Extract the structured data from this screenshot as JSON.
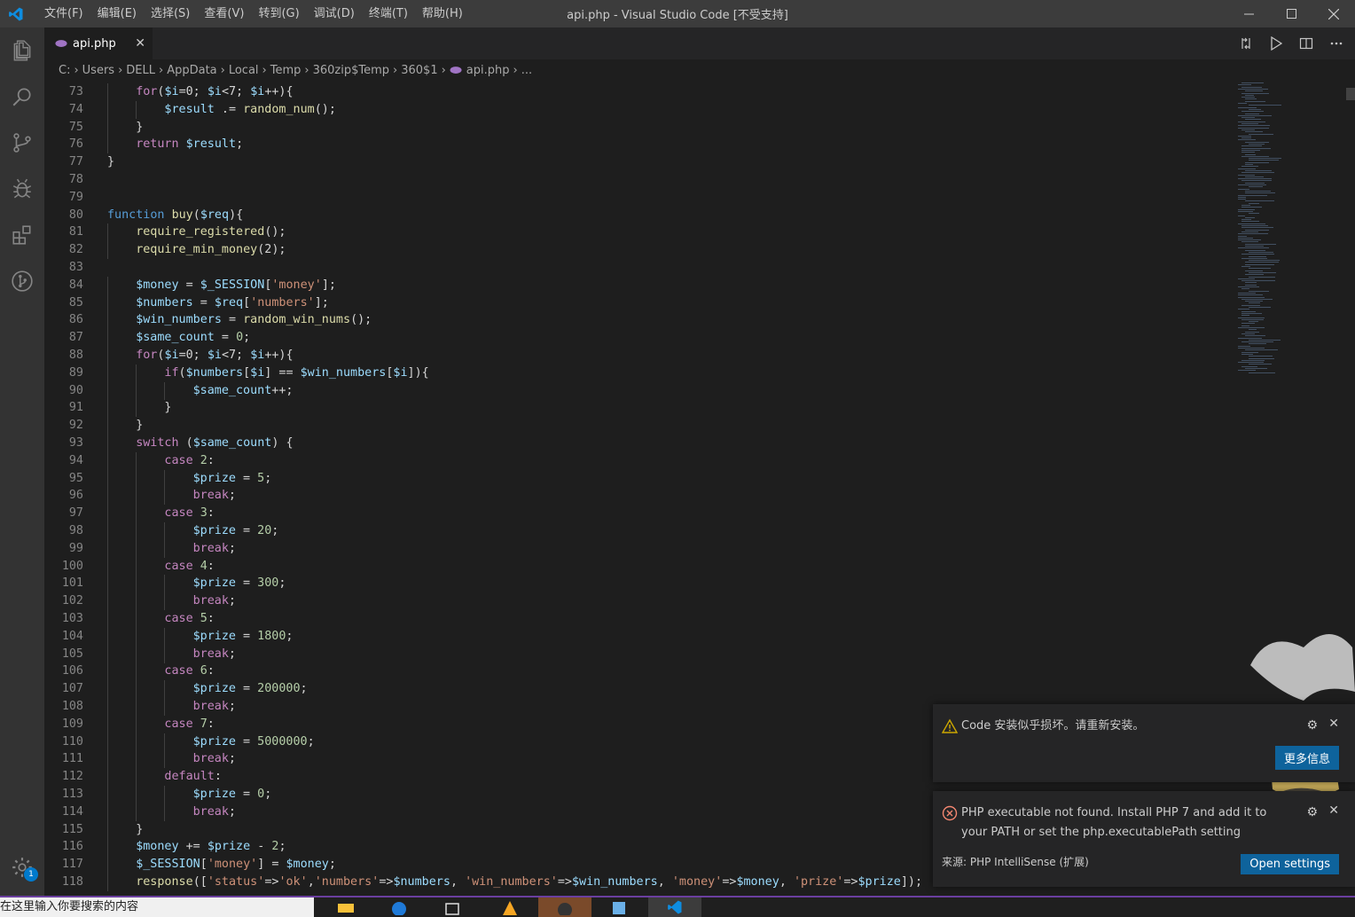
{
  "titlebar": {
    "menu": [
      "文件(F)",
      "编辑(E)",
      "选择(S)",
      "查看(V)",
      "转到(G)",
      "调试(D)",
      "终端(T)",
      "帮助(H)"
    ],
    "title": "api.php - Visual Studio Code [不受支持]"
  },
  "tab": {
    "label": "api.php"
  },
  "breadcrumb": [
    "C:",
    "Users",
    "DELL",
    "AppData",
    "Local",
    "Temp",
    "360zip$Temp",
    "360$1",
    "api.php",
    "..."
  ],
  "editor": {
    "lines": [
      {
        "n": "73",
        "indent": 1,
        "tokens": [
          [
            "ctl",
            "for"
          ],
          [
            "p",
            "("
          ],
          [
            "var",
            "$i"
          ],
          [
            "p",
            "=0; "
          ],
          [
            "var",
            "$i"
          ],
          [
            "p",
            "<7; "
          ],
          [
            "var",
            "$i"
          ],
          [
            "p",
            "++){"
          ]
        ]
      },
      {
        "n": "74",
        "indent": 2,
        "tokens": [
          [
            "var",
            "$result"
          ],
          [
            "p",
            " .= "
          ],
          [
            "fn",
            "random_num"
          ],
          [
            "p",
            "();"
          ]
        ]
      },
      {
        "n": "75",
        "indent": 1,
        "tokens": [
          [
            "p",
            "}"
          ]
        ]
      },
      {
        "n": "76",
        "indent": 1,
        "tokens": [
          [
            "ctl",
            "return"
          ],
          [
            "p",
            " "
          ],
          [
            "var",
            "$result"
          ],
          [
            "p",
            ";"
          ]
        ]
      },
      {
        "n": "77",
        "indent": 0,
        "tokens": [
          [
            "p",
            "}"
          ]
        ]
      },
      {
        "n": "78",
        "indent": 0,
        "tokens": []
      },
      {
        "n": "79",
        "indent": 0,
        "tokens": []
      },
      {
        "n": "80",
        "indent": 0,
        "tokens": [
          [
            "kw",
            "function"
          ],
          [
            "p",
            " "
          ],
          [
            "fn",
            "buy"
          ],
          [
            "p",
            "("
          ],
          [
            "var",
            "$req"
          ],
          [
            "p",
            "){"
          ]
        ]
      },
      {
        "n": "81",
        "indent": 1,
        "tokens": [
          [
            "fn",
            "require_registered"
          ],
          [
            "p",
            "();"
          ]
        ]
      },
      {
        "n": "82",
        "indent": 1,
        "tokens": [
          [
            "fn",
            "require_min_money"
          ],
          [
            "p",
            "(2);"
          ]
        ]
      },
      {
        "n": "83",
        "indent": 0,
        "tokens": []
      },
      {
        "n": "84",
        "indent": 1,
        "tokens": [
          [
            "var",
            "$money"
          ],
          [
            "p",
            " = "
          ],
          [
            "var",
            "$_SESSION"
          ],
          [
            "p",
            "["
          ],
          [
            "str",
            "'money'"
          ],
          [
            "p",
            "];"
          ]
        ]
      },
      {
        "n": "85",
        "indent": 1,
        "tokens": [
          [
            "var",
            "$numbers"
          ],
          [
            "p",
            " = "
          ],
          [
            "var",
            "$req"
          ],
          [
            "p",
            "["
          ],
          [
            "str",
            "'numbers'"
          ],
          [
            "p",
            "];"
          ]
        ]
      },
      {
        "n": "86",
        "indent": 1,
        "tokens": [
          [
            "var",
            "$win_numbers"
          ],
          [
            "p",
            " = "
          ],
          [
            "fn",
            "random_win_nums"
          ],
          [
            "p",
            "();"
          ]
        ]
      },
      {
        "n": "87",
        "indent": 1,
        "tokens": [
          [
            "var",
            "$same_count"
          ],
          [
            "p",
            " = "
          ],
          [
            "num",
            "0"
          ],
          [
            "p",
            ";"
          ]
        ]
      },
      {
        "n": "88",
        "indent": 1,
        "tokens": [
          [
            "ctl",
            "for"
          ],
          [
            "p",
            "("
          ],
          [
            "var",
            "$i"
          ],
          [
            "p",
            "=0; "
          ],
          [
            "var",
            "$i"
          ],
          [
            "p",
            "<7; "
          ],
          [
            "var",
            "$i"
          ],
          [
            "p",
            "++){"
          ]
        ]
      },
      {
        "n": "89",
        "indent": 2,
        "tokens": [
          [
            "ctl",
            "if"
          ],
          [
            "p",
            "("
          ],
          [
            "var",
            "$numbers"
          ],
          [
            "p",
            "["
          ],
          [
            "var",
            "$i"
          ],
          [
            "p",
            "] == "
          ],
          [
            "var",
            "$win_numbers"
          ],
          [
            "p",
            "["
          ],
          [
            "var",
            "$i"
          ],
          [
            "p",
            "]){"
          ]
        ]
      },
      {
        "n": "90",
        "indent": 3,
        "tokens": [
          [
            "var",
            "$same_count"
          ],
          [
            "p",
            "++;"
          ]
        ]
      },
      {
        "n": "91",
        "indent": 2,
        "tokens": [
          [
            "p",
            "}"
          ]
        ]
      },
      {
        "n": "92",
        "indent": 1,
        "tokens": [
          [
            "p",
            "}"
          ]
        ]
      },
      {
        "n": "93",
        "indent": 1,
        "tokens": [
          [
            "ctl",
            "switch"
          ],
          [
            "p",
            " ("
          ],
          [
            "var",
            "$same_count"
          ],
          [
            "p",
            ") {"
          ]
        ]
      },
      {
        "n": "94",
        "indent": 2,
        "tokens": [
          [
            "ctl",
            "case"
          ],
          [
            "p",
            " "
          ],
          [
            "num",
            "2"
          ],
          [
            "p",
            ":"
          ]
        ]
      },
      {
        "n": "95",
        "indent": 3,
        "tokens": [
          [
            "var",
            "$prize"
          ],
          [
            "p",
            " = "
          ],
          [
            "num",
            "5"
          ],
          [
            "p",
            ";"
          ]
        ]
      },
      {
        "n": "96",
        "indent": 3,
        "tokens": [
          [
            "ctl",
            "break"
          ],
          [
            "p",
            ";"
          ]
        ]
      },
      {
        "n": "97",
        "indent": 2,
        "tokens": [
          [
            "ctl",
            "case"
          ],
          [
            "p",
            " "
          ],
          [
            "num",
            "3"
          ],
          [
            "p",
            ":"
          ]
        ]
      },
      {
        "n": "98",
        "indent": 3,
        "tokens": [
          [
            "var",
            "$prize"
          ],
          [
            "p",
            " = "
          ],
          [
            "num",
            "20"
          ],
          [
            "p",
            ";"
          ]
        ]
      },
      {
        "n": "99",
        "indent": 3,
        "tokens": [
          [
            "ctl",
            "break"
          ],
          [
            "p",
            ";"
          ]
        ]
      },
      {
        "n": "100",
        "indent": 2,
        "tokens": [
          [
            "ctl",
            "case"
          ],
          [
            "p",
            " "
          ],
          [
            "num",
            "4"
          ],
          [
            "p",
            ":"
          ]
        ]
      },
      {
        "n": "101",
        "indent": 3,
        "tokens": [
          [
            "var",
            "$prize"
          ],
          [
            "p",
            " = "
          ],
          [
            "num",
            "300"
          ],
          [
            "p",
            ";"
          ]
        ]
      },
      {
        "n": "102",
        "indent": 3,
        "tokens": [
          [
            "ctl",
            "break"
          ],
          [
            "p",
            ";"
          ]
        ]
      },
      {
        "n": "103",
        "indent": 2,
        "tokens": [
          [
            "ctl",
            "case"
          ],
          [
            "p",
            " "
          ],
          [
            "num",
            "5"
          ],
          [
            "p",
            ":"
          ]
        ]
      },
      {
        "n": "104",
        "indent": 3,
        "tokens": [
          [
            "var",
            "$prize"
          ],
          [
            "p",
            " = "
          ],
          [
            "num",
            "1800"
          ],
          [
            "p",
            ";"
          ]
        ]
      },
      {
        "n": "105",
        "indent": 3,
        "tokens": [
          [
            "ctl",
            "break"
          ],
          [
            "p",
            ";"
          ]
        ]
      },
      {
        "n": "106",
        "indent": 2,
        "tokens": [
          [
            "ctl",
            "case"
          ],
          [
            "p",
            " "
          ],
          [
            "num",
            "6"
          ],
          [
            "p",
            ":"
          ]
        ]
      },
      {
        "n": "107",
        "indent": 3,
        "tokens": [
          [
            "var",
            "$prize"
          ],
          [
            "p",
            " = "
          ],
          [
            "num",
            "200000"
          ],
          [
            "p",
            ";"
          ]
        ]
      },
      {
        "n": "108",
        "indent": 3,
        "tokens": [
          [
            "ctl",
            "break"
          ],
          [
            "p",
            ";"
          ]
        ]
      },
      {
        "n": "109",
        "indent": 2,
        "tokens": [
          [
            "ctl",
            "case"
          ],
          [
            "p",
            " "
          ],
          [
            "num",
            "7"
          ],
          [
            "p",
            ":"
          ]
        ]
      },
      {
        "n": "110",
        "indent": 3,
        "tokens": [
          [
            "var",
            "$prize"
          ],
          [
            "p",
            " = "
          ],
          [
            "num",
            "5000000"
          ],
          [
            "p",
            ";"
          ]
        ]
      },
      {
        "n": "111",
        "indent": 3,
        "tokens": [
          [
            "ctl",
            "break"
          ],
          [
            "p",
            ";"
          ]
        ]
      },
      {
        "n": "112",
        "indent": 2,
        "tokens": [
          [
            "ctl",
            "default"
          ],
          [
            "p",
            ":"
          ]
        ]
      },
      {
        "n": "113",
        "indent": 3,
        "tokens": [
          [
            "var",
            "$prize"
          ],
          [
            "p",
            " = "
          ],
          [
            "num",
            "0"
          ],
          [
            "p",
            ";"
          ]
        ]
      },
      {
        "n": "114",
        "indent": 3,
        "tokens": [
          [
            "ctl",
            "break"
          ],
          [
            "p",
            ";"
          ]
        ]
      },
      {
        "n": "115",
        "indent": 1,
        "tokens": [
          [
            "p",
            "}"
          ]
        ]
      },
      {
        "n": "116",
        "indent": 1,
        "tokens": [
          [
            "var",
            "$money"
          ],
          [
            "p",
            " += "
          ],
          [
            "var",
            "$prize"
          ],
          [
            "p",
            " - "
          ],
          [
            "num",
            "2"
          ],
          [
            "p",
            ";"
          ]
        ]
      },
      {
        "n": "117",
        "indent": 1,
        "tokens": [
          [
            "var",
            "$_SESSION"
          ],
          [
            "p",
            "["
          ],
          [
            "str",
            "'money'"
          ],
          [
            "p",
            "] = "
          ],
          [
            "var",
            "$money"
          ],
          [
            "p",
            ";"
          ]
        ]
      },
      {
        "n": "118",
        "indent": 1,
        "tokens": [
          [
            "fn",
            "response"
          ],
          [
            "p",
            "(["
          ],
          [
            "str",
            "'status'"
          ],
          [
            "p",
            "=>"
          ],
          [
            "str",
            "'ok'"
          ],
          [
            "p",
            ","
          ],
          [
            "str",
            "'numbers'"
          ],
          [
            "p",
            "=>"
          ],
          [
            "var",
            "$numbers"
          ],
          [
            "p",
            ", "
          ],
          [
            "str",
            "'win_numbers'"
          ],
          [
            "p",
            "=>"
          ],
          [
            "var",
            "$win_numbers"
          ],
          [
            "p",
            ", "
          ],
          [
            "str",
            "'money'"
          ],
          [
            "p",
            "=>"
          ],
          [
            "var",
            "$money"
          ],
          [
            "p",
            ", "
          ],
          [
            "str",
            "'prize'"
          ],
          [
            "p",
            "=>"
          ],
          [
            "var",
            "$prize"
          ],
          [
            "p",
            "]);"
          ]
        ]
      }
    ]
  },
  "notifications": {
    "corrupt": {
      "message": "Code 安装似乎损坏。请重新安装。",
      "button": "更多信息"
    },
    "php": {
      "message": "PHP executable not found. Install PHP 7 and add it to your PATH or set the php.executablePath setting",
      "source": "来源: PHP IntelliSense (扩展)",
      "button": "Open settings"
    }
  },
  "activitybar": {
    "badge": "1"
  },
  "taskbar": {
    "search_text": "在这里输入你要搜索的内容"
  },
  "colors": {
    "accent": "#007acc",
    "button": "#0e639c",
    "warning": "#cca700",
    "error": "#f48771"
  }
}
